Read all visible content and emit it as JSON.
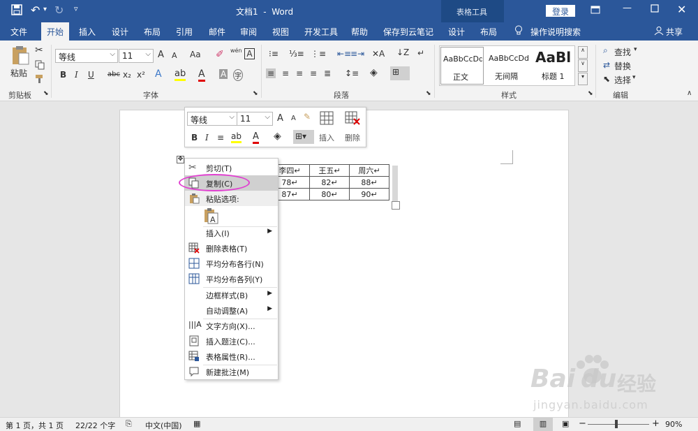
{
  "titlebar": {
    "title": "文档1  -  Word",
    "context_group": "表格工具",
    "login": "登录",
    "undo_arrow": "▾"
  },
  "tabs": {
    "file": "文件",
    "home": "开始",
    "insert": "插入",
    "design": "设计",
    "layout": "布局",
    "references": "引用",
    "mailings": "邮件",
    "review": "审阅",
    "view": "视图",
    "developer": "开发工具",
    "help": "帮助",
    "save_cloud": "保存到云笔记",
    "table_design": "设计",
    "table_layout": "布局",
    "tell_me": "操作说明搜索",
    "share": "共享"
  },
  "ribbon": {
    "clipboard": {
      "paste": "粘贴",
      "label": "剪贴板"
    },
    "font": {
      "name": "等线",
      "size": "11",
      "label": "字体",
      "grow": "A",
      "shrink": "A",
      "case": "Aa",
      "bold": "B",
      "italic": "I",
      "underline": "U",
      "strike": "abc",
      "sub": "x₂",
      "sup": "x²",
      "phonetic": "wén",
      "charborder": "A",
      "fontcolor": "A",
      "shade": "A",
      "enclose": "字"
    },
    "paragraph": {
      "label": "段落"
    },
    "styles": {
      "label": "样式",
      "items": [
        {
          "preview": "AaBbCcDd",
          "name": "正文"
        },
        {
          "preview": "AaBbCcDd",
          "name": "无间隔"
        },
        {
          "preview": "AaBl",
          "name": "标题 1"
        }
      ]
    },
    "editing": {
      "label": "编辑",
      "find": "查找",
      "replace": "替换",
      "select": "选择"
    }
  },
  "minibar": {
    "font": "等线",
    "size": "11",
    "grow": "A",
    "shrink": "A",
    "bold": "B",
    "italic": "I",
    "insert": "插入",
    "delete": "删除"
  },
  "table": {
    "rows": [
      [
        "李四↵",
        "王五↵",
        "周六↵"
      ],
      [
        "78↵",
        "82↵",
        "88↵"
      ],
      [
        "87↵",
        "80↵",
        "90↵"
      ]
    ]
  },
  "context_menu": {
    "items": [
      {
        "label": "剪切(T)"
      },
      {
        "label": "复制(C)"
      },
      {
        "label": "粘贴选项:"
      },
      {
        "label": "插入(I)"
      },
      {
        "label": "删除表格(T)"
      },
      {
        "label": "平均分布各行(N)"
      },
      {
        "label": "平均分布各列(Y)"
      },
      {
        "label": "边框样式(B)"
      },
      {
        "label": "自动调整(A)"
      },
      {
        "label": "文字方向(X)..."
      },
      {
        "label": "插入题注(C)..."
      },
      {
        "label": "表格属性(R)..."
      },
      {
        "label": "新建批注(M)"
      }
    ]
  },
  "statusbar": {
    "page": "第 1 页，共 1 页",
    "words": "22/22 个字",
    "language": "中文(中国)",
    "zoom": "90%",
    "minus": "−",
    "plus": "+"
  },
  "watermark": {
    "brand": "Bai",
    "du": "du",
    "jingyan": "经验",
    "url": "jingyan.baidu.com"
  },
  "colors": {
    "brand": "#2b579a",
    "highlight_oval": "#e040d0",
    "font_red": "#e00000",
    "highlight_yellow": "#ffff00"
  }
}
